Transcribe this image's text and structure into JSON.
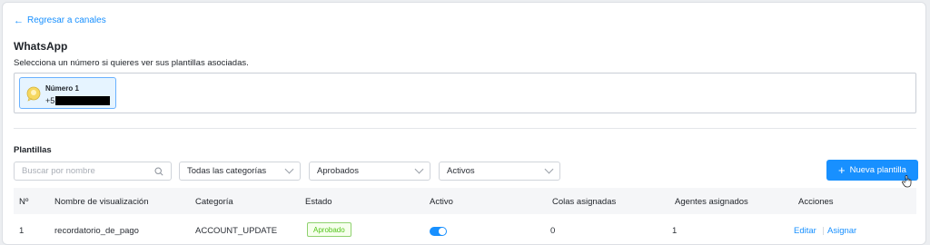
{
  "nav": {
    "back_label": "Regresar a canales"
  },
  "header": {
    "title": "WhatsApp",
    "subtitle": "Selecciona un número si quieres ver sus plantillas asociadas."
  },
  "numbers": [
    {
      "label": "Número 1",
      "value": "+5"
    }
  ],
  "templates": {
    "section_title": "Plantillas",
    "search_placeholder": "Buscar por nombre",
    "filters": {
      "category": "Todas las categorías",
      "status": "Aprobados",
      "active": "Activos"
    },
    "new_button": "Nueva plantilla",
    "columns": [
      "Nº",
      "Nombre de visualización",
      "Categoría",
      "Estado",
      "Activo",
      "Colas asignadas",
      "Agentes asignados",
      "Acciones"
    ],
    "rows": [
      {
        "num": "1",
        "name": "recordatorio_de_pago",
        "category": "ACCOUNT_UPDATE",
        "status": "Aprobado",
        "active": true,
        "queues": "0",
        "agents": "1",
        "actions": {
          "edit": "Editar",
          "assign": "Asignar"
        }
      }
    ]
  },
  "colors": {
    "accent": "#1890ff",
    "success": "#52c41a",
    "selected_bg": "#e6f4ff"
  }
}
